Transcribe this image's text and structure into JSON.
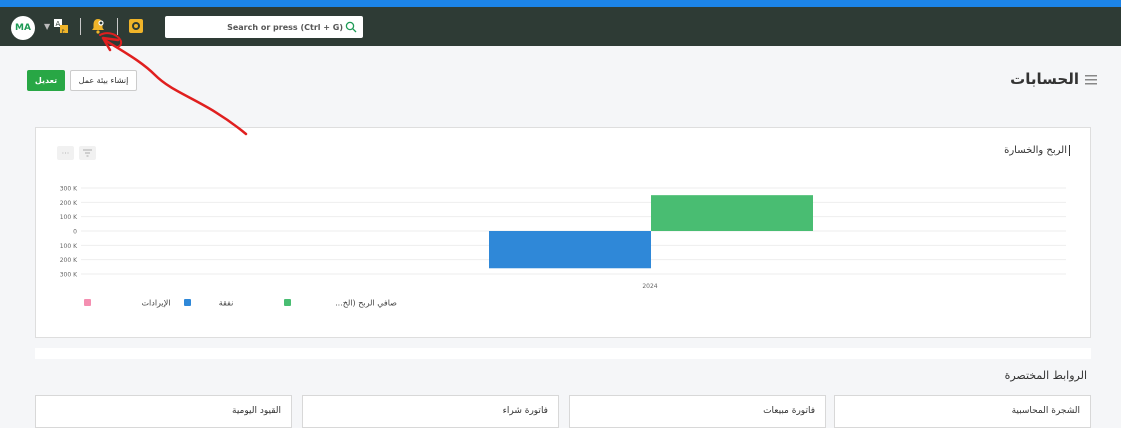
{
  "navbar": {
    "user_initials": "MA",
    "search_placeholder": "Search or press (Ctrl + G)",
    "icons": [
      "chevron-down-icon",
      "translate-icon",
      "bell-icon",
      "badge-icon",
      "search-icon"
    ]
  },
  "page": {
    "title": "الحسابات",
    "edit_button": "تعديل",
    "create_workspace_button": "إنشاء بيئة عمل"
  },
  "chart_card": {
    "title": "الربح والخسارة",
    "tool_filter": "⁝",
    "tool_more": "···"
  },
  "chart_data": {
    "type": "bar",
    "categories": [
      "2024"
    ],
    "series": [
      {
        "name": "الإيرادات",
        "values": [
          0
        ],
        "color": "#f48fb1"
      },
      {
        "name": "نفقة",
        "values": [
          -260000
        ],
        "color": "#2f88d8"
      },
      {
        "name": "...صافي الربح (الخ",
        "values": [
          250000
        ],
        "color": "#49bd72"
      }
    ],
    "y_ticks": [
      "300 K",
      "200 K",
      "100 K",
      "0",
      "100 K",
      "200 K",
      "300 K"
    ],
    "ylim": [
      -300000,
      300000
    ],
    "grid": true,
    "legend": "bottom"
  },
  "shortcuts": {
    "title": "الروابط المختصرة",
    "links": [
      "الشجرة المحاسبية",
      "فاتورة مبيعات",
      "فاتورة شراء",
      "القيود اليومية"
    ]
  },
  "colors": {
    "accent_blue": "#1c84e8",
    "navbar_bg": "#2e3b35",
    "edit_green": "#28a745",
    "annotation_red": "#e01f1f"
  }
}
